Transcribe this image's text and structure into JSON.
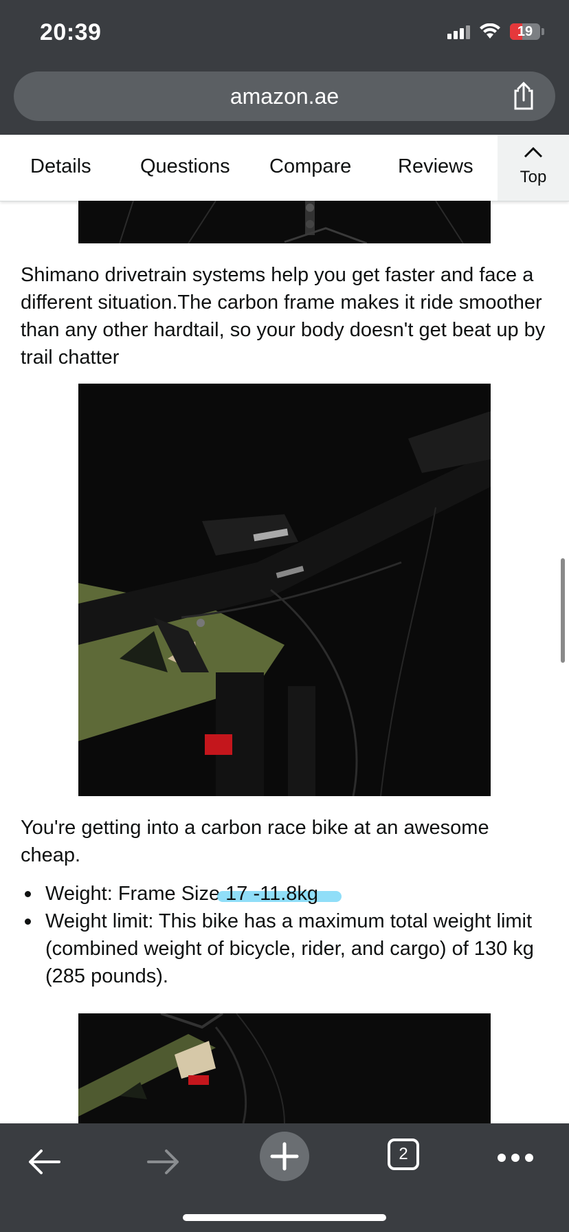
{
  "status_bar": {
    "time": "20:39",
    "battery": "19"
  },
  "browser": {
    "url": "amazon.ae"
  },
  "nav_tabs": {
    "items": [
      "Details",
      "Questions",
      "Compare",
      "Reviews"
    ],
    "top_label": "Top"
  },
  "content": {
    "paragraph1": "Shimano drivetrain systems help you get faster and face a different situation.The carbon frame makes it ride smoother than any other hardtail, so your body doesn't get beat up by trail chatter",
    "paragraph2": "You're getting into a carbon race bike at an awesome cheap.",
    "bullet1_prefix": "Weight: Frame Size",
    "bullet1_highlight": " 17 -11.8kg",
    "bullet2": "Weight limit: This bike has a maximum total weight limit (combined weight of bicycle, rider, and cargo) of 130 kg (285 pounds)."
  },
  "toolbar": {
    "tab_count": "2"
  },
  "colors": {
    "chrome": "#3a3d41",
    "urlbar": "#5b5f63",
    "highlight": "#7dd8f7",
    "battery_low": "#e5383b",
    "frame_green": "#5e6a38"
  }
}
